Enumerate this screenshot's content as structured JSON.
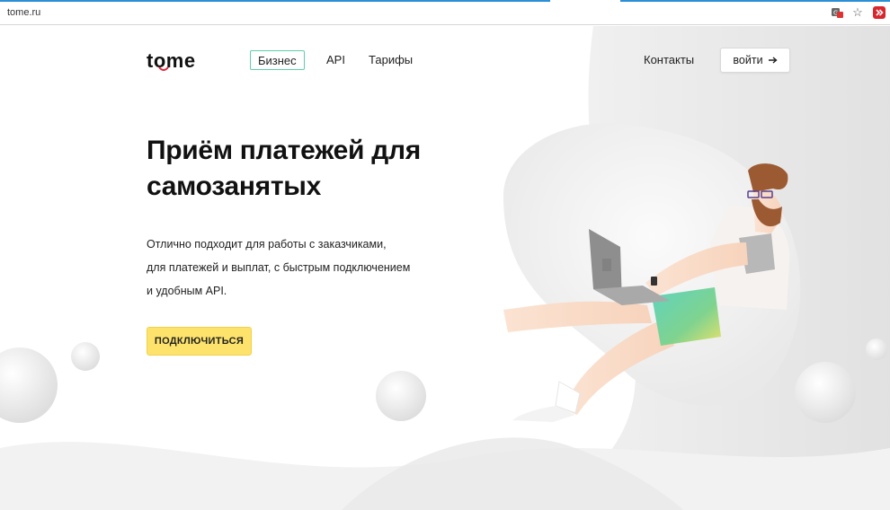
{
  "browser": {
    "url": "tome.ru",
    "icons": [
      "translate-icon",
      "star-icon",
      "extension-icon"
    ]
  },
  "header": {
    "logo": "tome",
    "nav": [
      {
        "label": "Бизнес",
        "active": true
      },
      {
        "label": "API",
        "active": false
      },
      {
        "label": "Тарифы",
        "active": false
      }
    ],
    "contacts": "Контакты",
    "login": "войти"
  },
  "hero": {
    "title_line1": "Приём платежей для",
    "title_line2": "самозанятых",
    "desc_line1": "Отлично подходит для работы с заказчиками,",
    "desc_line2": "для платежей и выплат, с быстрым подключением",
    "desc_line3": "и удобным API.",
    "cta": "ПОДКЛЮЧИТЬСЯ"
  },
  "colors": {
    "accent_yellow": "#fde36b",
    "nav_active_border": "#5fcfa9",
    "logo_smile": "#e0263a"
  }
}
